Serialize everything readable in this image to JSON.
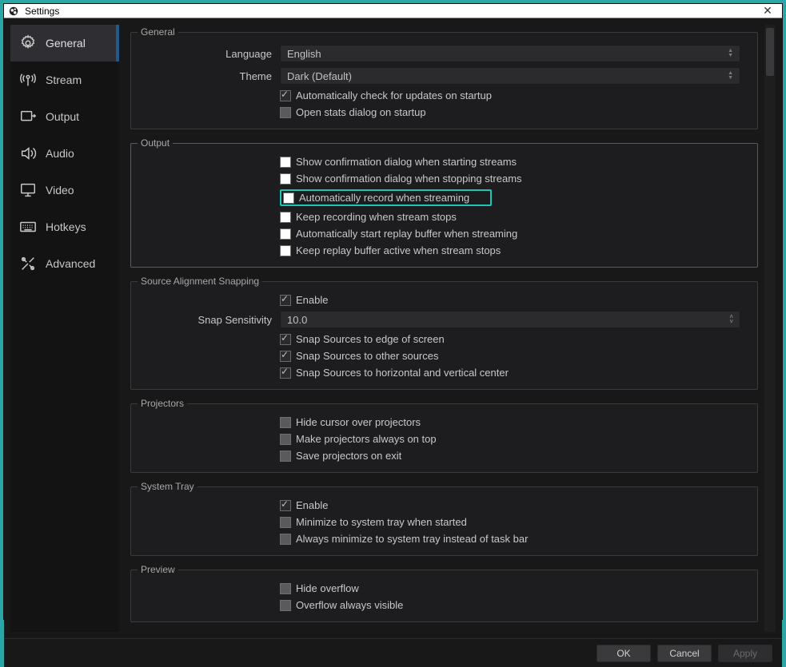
{
  "window": {
    "title": "Settings"
  },
  "sidebar": {
    "items": [
      {
        "label": "General"
      },
      {
        "label": "Stream"
      },
      {
        "label": "Output"
      },
      {
        "label": "Audio"
      },
      {
        "label": "Video"
      },
      {
        "label": "Hotkeys"
      },
      {
        "label": "Advanced"
      }
    ]
  },
  "groups": {
    "general": {
      "legend": "General",
      "language_label": "Language",
      "language_value": "English",
      "theme_label": "Theme",
      "theme_value": "Dark (Default)",
      "auto_update": "Automatically check for updates on startup",
      "open_stats": "Open stats dialog on startup"
    },
    "output": {
      "legend": "Output",
      "confirm_start": "Show confirmation dialog when starting streams",
      "confirm_stop": "Show confirmation dialog when stopping streams",
      "auto_record": "Automatically record when streaming",
      "keep_recording": "Keep recording when stream stops",
      "auto_replay": "Automatically start replay buffer when streaming",
      "keep_replay": "Keep replay buffer active when stream stops"
    },
    "snapping": {
      "legend": "Source Alignment Snapping",
      "enable": "Enable",
      "sensitivity_label": "Snap Sensitivity",
      "sensitivity_value": "10.0",
      "edge": "Snap Sources to edge of screen",
      "other": "Snap Sources to other sources",
      "center": "Snap Sources to horizontal and vertical center"
    },
    "projectors": {
      "legend": "Projectors",
      "hide_cursor": "Hide cursor over projectors",
      "always_top": "Make projectors always on top",
      "save_exit": "Save projectors on exit"
    },
    "tray": {
      "legend": "System Tray",
      "enable": "Enable",
      "minimize_start": "Minimize to system tray when started",
      "always_minimize": "Always minimize to system tray instead of task bar"
    },
    "preview": {
      "legend": "Preview",
      "hide_overflow": "Hide overflow",
      "overflow_visible": "Overflow always visible"
    }
  },
  "footer": {
    "ok": "OK",
    "cancel": "Cancel",
    "apply": "Apply"
  }
}
